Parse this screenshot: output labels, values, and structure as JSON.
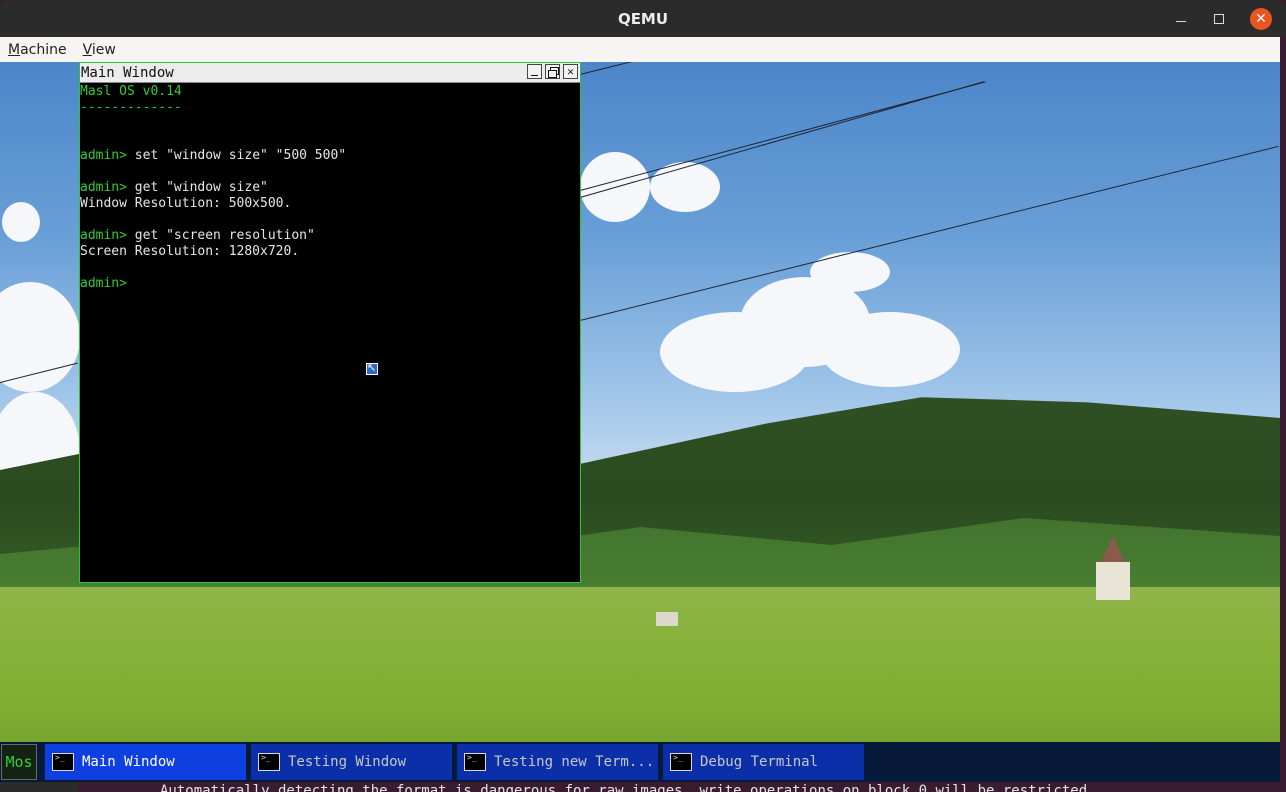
{
  "host_window": {
    "title": "QEMU",
    "menu": [
      "Machine",
      "View"
    ]
  },
  "terminal": {
    "title": "Main Window",
    "lines": [
      {
        "prompt": "",
        "text": "Masl OS v0.14",
        "color": "green"
      },
      {
        "prompt": "",
        "text": "-------------",
        "color": "green"
      },
      {
        "prompt": "",
        "text": ""
      },
      {
        "prompt": "",
        "text": ""
      },
      {
        "prompt": "admin>",
        "text": " set \"window size\" \"500 500\""
      },
      {
        "prompt": "",
        "text": ""
      },
      {
        "prompt": "admin>",
        "text": " get \"window size\""
      },
      {
        "prompt": "",
        "text": "Window Resolution: 500x500."
      },
      {
        "prompt": "",
        "text": ""
      },
      {
        "prompt": "admin>",
        "text": " get \"screen resolution\""
      },
      {
        "prompt": "",
        "text": "Screen Resolution: 1280x720."
      },
      {
        "prompt": "",
        "text": ""
      },
      {
        "prompt": "admin>",
        "text": ""
      }
    ]
  },
  "taskbar": {
    "start_label": "Mos",
    "tasks": [
      {
        "label": "Main Window",
        "active": true
      },
      {
        "label": "Testing Window",
        "active": false
      },
      {
        "label": "Testing new Term...",
        "active": false
      },
      {
        "label": "Debug Terminal",
        "active": false
      }
    ]
  },
  "host_terminal": {
    "bottom_text": "Automatically detecting the format is dangerous for raw images, write operations on block 0 will be restricted"
  },
  "colors": {
    "terminal_green": "#33cc33",
    "taskbar_bg": "#071a3a",
    "task_active": "#0e3fe0",
    "task_inactive": "#0b2fa8",
    "host_close": "#e95420"
  }
}
